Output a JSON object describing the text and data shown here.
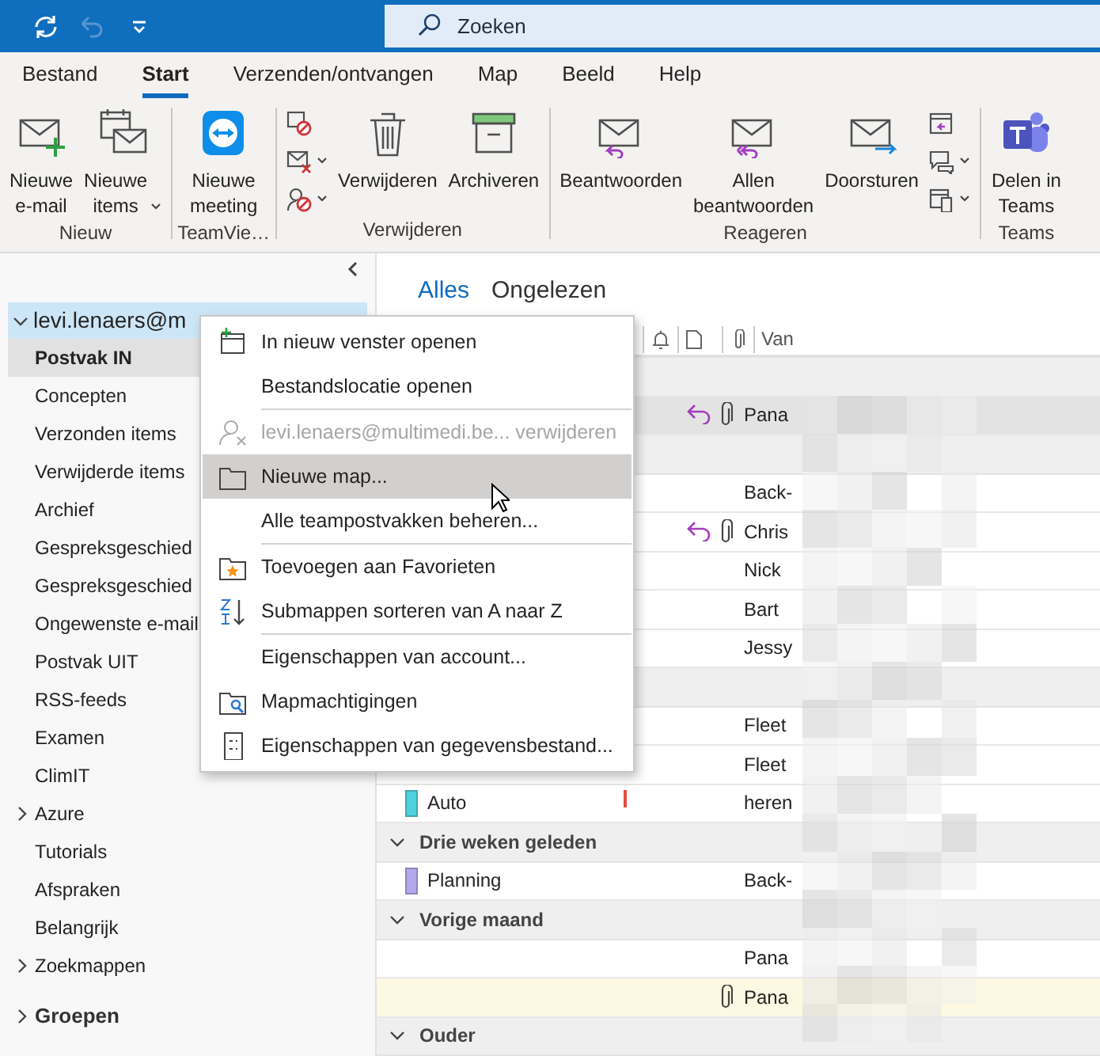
{
  "title_bar": {
    "search": {
      "placeholder": "Zoeken"
    }
  },
  "menu_tabs": [
    {
      "label": "Bestand",
      "selected": false
    },
    {
      "label": "Start",
      "selected": true
    },
    {
      "label": "Verzenden/ontvangen",
      "selected": false
    },
    {
      "label": "Map",
      "selected": false
    },
    {
      "label": "Beeld",
      "selected": false
    },
    {
      "label": "Help",
      "selected": false
    }
  ],
  "ribbon_groups": [
    {
      "label": "Nieuw",
      "buttons": [
        {
          "kind": "large",
          "lines": [
            "Nieuwe",
            "e-mail"
          ],
          "dropdown": false
        },
        {
          "kind": "large",
          "lines": [
            "Nieuwe",
            "items"
          ],
          "dropdown": true
        }
      ]
    },
    {
      "label": "TeamVie…",
      "buttons": [
        {
          "kind": "large",
          "lines": [
            "Nieuwe",
            "meeting"
          ],
          "dropdown": false
        }
      ]
    },
    {
      "label": "Verwijderen",
      "buttons": [
        {
          "kind": "small-stack",
          "items": [
            {
              "dropdown": false
            },
            {
              "dropdown": true
            },
            {
              "dropdown": true
            }
          ]
        },
        {
          "kind": "large",
          "lines": [
            "Verwijderen"
          ],
          "dropdown": false
        },
        {
          "kind": "large",
          "lines": [
            "Archiveren"
          ],
          "dropdown": false
        }
      ]
    },
    {
      "label": "Reageren",
      "buttons": [
        {
          "kind": "large",
          "lines": [
            "Beantwoorden"
          ],
          "dropdown": false
        },
        {
          "kind": "large",
          "lines": [
            "Allen",
            "beantwoorden"
          ],
          "dropdown": false
        },
        {
          "kind": "large",
          "lines": [
            "Doorsturen"
          ],
          "dropdown": false
        },
        {
          "kind": "small-stack",
          "items": [
            {
              "dropdown": false
            },
            {
              "dropdown": true
            },
            {
              "dropdown": true
            }
          ]
        }
      ]
    },
    {
      "label": "Teams",
      "buttons": [
        {
          "kind": "large",
          "lines": [
            "Delen in",
            "Teams"
          ],
          "dropdown": false
        }
      ]
    }
  ],
  "folder_pane": {
    "account": {
      "label": "levi.lenaers@m",
      "expanded": true,
      "children": [
        {
          "label": "Postvak IN",
          "selected": true
        },
        {
          "label": "Concepten",
          "selected": false
        },
        {
          "label": "Verzonden items",
          "selected": false
        },
        {
          "label": "Verwijderde items",
          "selected": false
        },
        {
          "label": "Archief",
          "selected": false
        },
        {
          "label": "Gespreksgeschied",
          "selected": false
        },
        {
          "label": "Gespreksgeschied",
          "selected": false
        },
        {
          "label": "Ongewenste e-mail",
          "selected": false
        },
        {
          "label": "Postvak UIT",
          "selected": false
        },
        {
          "label": "RSS-feeds",
          "selected": false
        },
        {
          "label": "Examen",
          "selected": false
        },
        {
          "label": "ClimIT",
          "selected": false
        },
        {
          "label": "Azure",
          "selected": false,
          "expanded": false
        },
        {
          "label": "Tutorials",
          "selected": false
        },
        {
          "label": "Afspraken",
          "selected": false
        },
        {
          "label": "Belangrijk",
          "selected": false
        },
        {
          "label": "Zoekmappen",
          "selected": false,
          "expanded": false
        }
      ]
    },
    "groups": {
      "label": "Groepen",
      "expanded": false
    }
  },
  "message_list": {
    "filters": [
      {
        "label": "Alles",
        "selected": true
      },
      {
        "label": "Ongelezen",
        "selected": false
      }
    ],
    "column_header": {
      "from": "Van"
    },
    "rows": [
      {
        "kind": "group"
      },
      {
        "kind": "mail",
        "sender": "Pana",
        "replied": true,
        "attachment": true,
        "selected": true,
        "highlighted": false
      },
      {
        "kind": "group"
      },
      {
        "kind": "mail",
        "sender": "Back-",
        "replied": false,
        "attachment": false,
        "selected": false,
        "highlighted": false
      },
      {
        "kind": "mail",
        "sender": "Chris",
        "replied": true,
        "attachment": true,
        "selected": false,
        "highlighted": false
      },
      {
        "kind": "mail",
        "sender": "Nick",
        "replied": false,
        "attachment": false,
        "selected": false,
        "highlighted": false
      },
      {
        "kind": "mail",
        "sender": "Bart",
        "replied": false,
        "attachment": false,
        "selected": false,
        "highlighted": false
      },
      {
        "kind": "mail",
        "sender": "Jessy",
        "replied": false,
        "attachment": false,
        "selected": false,
        "highlighted": false
      },
      {
        "kind": "group"
      },
      {
        "kind": "mail",
        "sender": "Fleet",
        "replied": false,
        "attachment": false,
        "selected": false,
        "highlighted": false
      },
      {
        "kind": "mail",
        "sender": "Fleet",
        "replied": false,
        "attachment": false,
        "selected": false,
        "highlighted": false
      },
      {
        "kind": "mail",
        "category": "Auto",
        "color": "#4fd1dd",
        "sender": "heren",
        "replied": false,
        "attachment": false,
        "important": true,
        "selected": false,
        "highlighted": false
      },
      {
        "kind": "group",
        "label": "Drie weken geleden",
        "expanded": true
      },
      {
        "kind": "mail",
        "category": "Planning",
        "color": "#b4a7ee",
        "sender": "Back-",
        "replied": false,
        "attachment": false,
        "important": false,
        "selected": false,
        "highlighted": false
      },
      {
        "kind": "group",
        "label": "Vorige maand",
        "expanded": true
      },
      {
        "kind": "mail",
        "sender": "Pana",
        "replied": false,
        "attachment": false,
        "important": false,
        "selected": false,
        "highlighted": false
      },
      {
        "kind": "mail",
        "sender": "Pana",
        "replied": false,
        "attachment": true,
        "important": false,
        "selected": false,
        "highlighted": true
      },
      {
        "kind": "group",
        "label": "Ouder",
        "expanded": true
      }
    ]
  },
  "context_menu": {
    "items": [
      {
        "kind": "item",
        "label": "In nieuw venster openen",
        "disabled": false,
        "highlighted": false
      },
      {
        "kind": "item",
        "label": "Bestandslocatie openen",
        "disabled": false,
        "highlighted": false
      },
      {
        "kind": "separator"
      },
      {
        "kind": "item",
        "label": "levi.lenaers@multimedi.be... verwijderen",
        "disabled": true,
        "highlighted": false
      },
      {
        "kind": "item",
        "label": "Nieuwe map...",
        "disabled": false,
        "highlighted": true
      },
      {
        "kind": "item",
        "label": "Alle teampostvakken beheren...",
        "disabled": false,
        "highlighted": false
      },
      {
        "kind": "separator"
      },
      {
        "kind": "item",
        "label": "Toevoegen aan Favorieten",
        "disabled": false,
        "highlighted": false
      },
      {
        "kind": "item",
        "label": "Submappen sorteren van A naar Z",
        "disabled": false,
        "highlighted": false
      },
      {
        "kind": "separator"
      },
      {
        "kind": "item",
        "label": "Eigenschappen van account...",
        "disabled": false,
        "highlighted": false
      },
      {
        "kind": "item",
        "label": "Mapmachtigingen",
        "disabled": false,
        "highlighted": false
      },
      {
        "kind": "item",
        "label": "Eigenschappen van gegevensbestand...",
        "disabled": false,
        "highlighted": false
      }
    ]
  }
}
